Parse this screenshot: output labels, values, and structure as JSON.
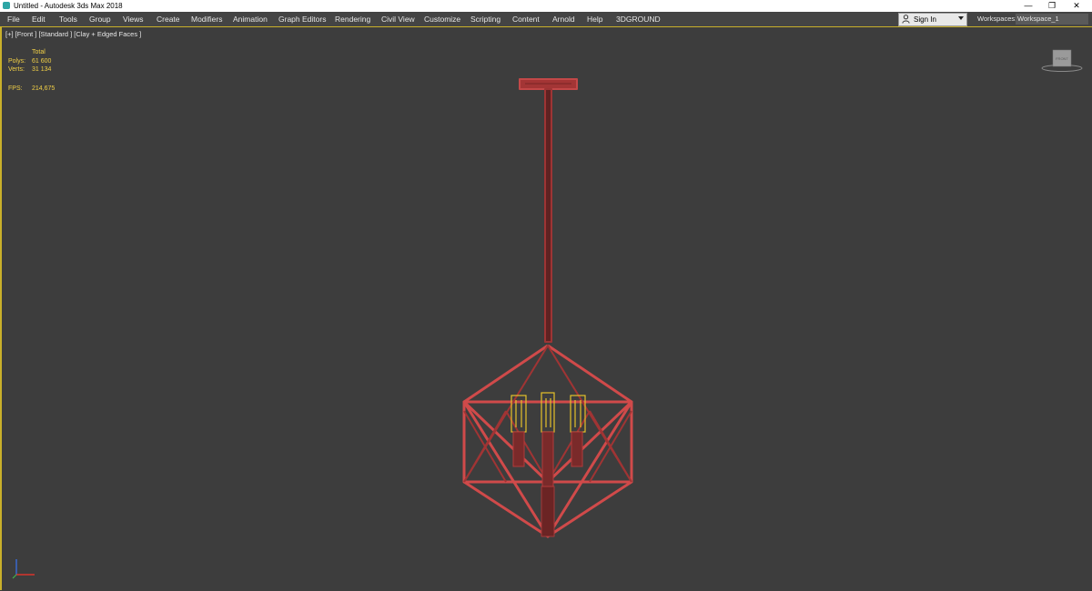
{
  "titlebar": {
    "title": "Untitled - Autodesk 3ds Max 2018",
    "minimize_glyph": "—",
    "maximize_glyph": "❐",
    "close_glyph": "✕"
  },
  "menubar": {
    "items": [
      "File",
      "Edit",
      "Tools",
      "Group",
      "Views",
      "Create",
      "Modifiers",
      "Animation",
      "Graph Editors",
      "Rendering",
      "Civil View",
      "Customize",
      "Scripting",
      "Content",
      "Arnold",
      "Help",
      "3DGROUND"
    ],
    "signin_label": "Sign In",
    "workspaces_label": "Workspaces:",
    "workspace_value": "Workspace_1"
  },
  "viewport": {
    "label": "[+] [Front ] [Standard ] [Clay + Edged Faces ]",
    "stats": {
      "total_header": "Total",
      "polys_label": "Polys:",
      "polys_value": "61 600",
      "verts_label": "Verts:",
      "verts_value": "31 134",
      "fps_label": "FPS:",
      "fps_value": "214,675"
    },
    "viewcube_label": "FRONT"
  },
  "colors": {
    "accent": "#c9b02a",
    "wire": "#b33b3b",
    "bulb": "#e6c22a",
    "viewport_bg": "#3d3d3d"
  }
}
